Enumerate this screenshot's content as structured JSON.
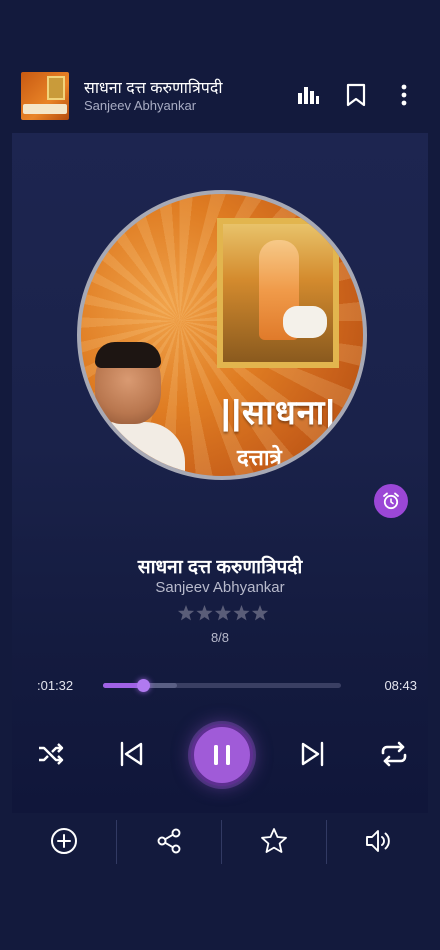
{
  "header": {
    "title": "साधना दत्त करुणात्रिपदी",
    "artist": "Sanjeev Abhyankar",
    "icons": [
      "equalizer-icon",
      "bookmark-icon",
      "more-vertical-icon"
    ]
  },
  "artwork": {
    "title_line1": "||साधना|",
    "title_line2": "दत्तात्रे"
  },
  "song": {
    "title": "साधना दत्त करुणात्रिपदी",
    "artist": "Sanjeev Abhyankar",
    "rating": 0,
    "rating_max": 5,
    "position_label": "8/8"
  },
  "progress": {
    "current": ":01:32",
    "total": "08:43",
    "played_fraction": 0.17,
    "buffered_fraction": 0.31
  },
  "controls": [
    "shuffle-icon",
    "previous-icon",
    "pause-icon",
    "next-icon",
    "repeat-icon"
  ],
  "bottom_actions": [
    "add-circle-icon",
    "share-icon",
    "star-icon",
    "volume-icon"
  ],
  "colors": {
    "background": "#131a3d",
    "accent": "#a05bd8",
    "progress": "#a062e6",
    "alarm": "#9b47d6"
  }
}
